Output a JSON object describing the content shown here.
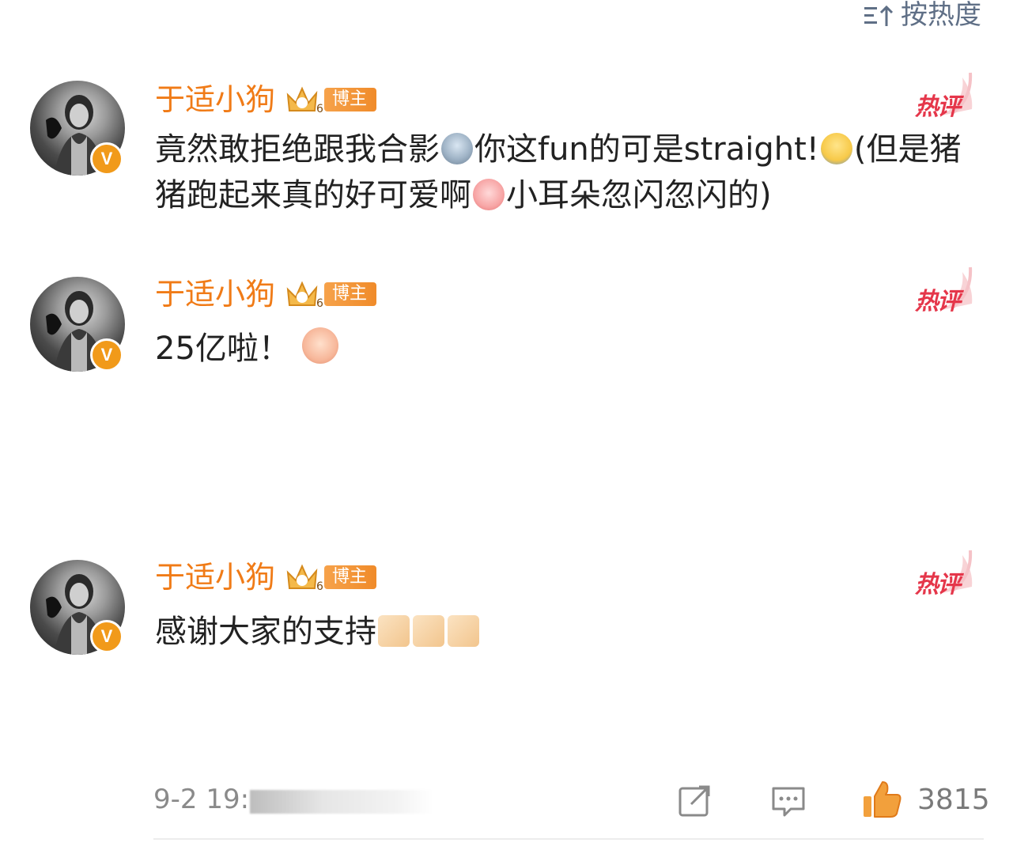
{
  "sort": {
    "label": "按热度"
  },
  "comments": [
    {
      "username": "于适小狗",
      "tag": "博主",
      "hot_label": "热评",
      "text_parts": [
        "竟然敢拒绝跟我合影",
        "你这fun的可是straight!",
        "(但是猪猪跑起来真的好可爱啊",
        "小耳朵忽闪忽闪的)"
      ]
    },
    {
      "username": "于适小狗",
      "tag": "博主",
      "hot_label": "热评",
      "text_parts": [
        "25亿啦！"
      ]
    },
    {
      "username": "于适小狗",
      "tag": "博主",
      "hot_label": "热评",
      "text_parts": [
        "感谢大家的支持"
      ]
    }
  ],
  "footer": {
    "time": "9-2 19:",
    "like_count": "3815"
  },
  "colors": {
    "username": "#f07b17",
    "hot": "#e5364a",
    "muted": "#8a8a8a",
    "sort": "#5f6f86"
  },
  "icons": [
    "sort-icon",
    "crown-icon",
    "hot-flame-icon",
    "share-icon",
    "comment-icon",
    "like-icon",
    "verified-v-icon"
  ]
}
